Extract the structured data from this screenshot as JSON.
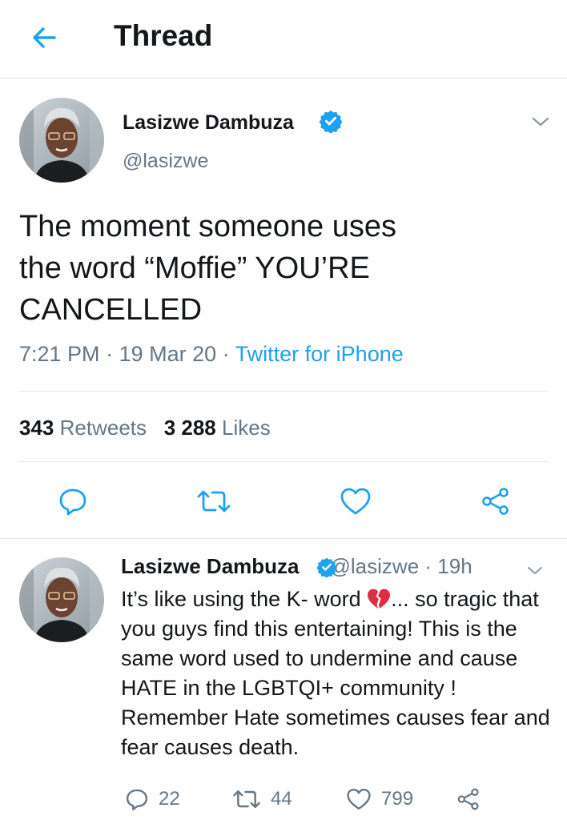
{
  "header": {
    "title": "Thread"
  },
  "main_tweet": {
    "author_name": "Lasizwe Dambuza",
    "author_handle": "@lasizwe",
    "text_lines": [
      "The moment someone uses",
      "the word “Moffie” YOU’RE",
      "CANCELLED"
    ],
    "time": "7:21 PM",
    "date": "19 Mar 20",
    "separator": " · ",
    "source": "Twitter for iPhone",
    "retweets_count": "343",
    "retweets_label": "Retweets",
    "likes_count": "3 288",
    "likes_label": "Likes"
  },
  "reply_tweet": {
    "author_name": "Lasizwe Dambuza",
    "author_handle": "@lasizwe",
    "time_ago": "· 19h",
    "text_before_emoji": "It’s like using the K- word ",
    "text_after_emoji": "... so tragic that you guys find this entertaining! This is the same word used to undermine and cause HATE in the LGBTQI+ community ! Remember Hate sometimes causes fear and fear causes death.",
    "reply_count": "22",
    "retweet_count": "44",
    "like_count": "799"
  },
  "icons": {
    "back": "arrow-left-icon",
    "verified": "verified-badge-icon",
    "caret": "chevron-down-icon",
    "reply": "reply-icon",
    "retweet": "retweet-icon",
    "like": "heart-icon",
    "share": "share-icon",
    "emoji": "broken-heart-emoji"
  },
  "colors": {
    "accent": "#1da1f2",
    "text": "#14171a",
    "secondary": "#657786",
    "divider": "#e1e8ed"
  }
}
